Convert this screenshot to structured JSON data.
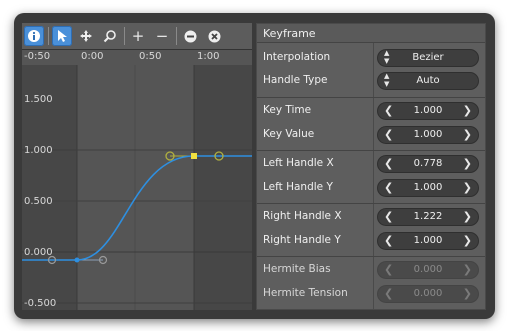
{
  "toolbar": {
    "info_icon": "info-icon",
    "select_icon": "arrow-icon",
    "pan_icon": "move-icon",
    "zoom_icon": "magnify-icon",
    "zoom_in_label": "+",
    "zoom_out_label": "−",
    "add_icon": "minus-circle-icon",
    "delete_icon": "close-circle-icon"
  },
  "ruler": {
    "ticks": [
      "-0:50",
      "0:00",
      "0:50",
      "1:00"
    ]
  },
  "y_labels": [
    "1.500",
    "1.000",
    "0.500",
    "0.000",
    "-0.500"
  ],
  "panel": {
    "title": "Keyframe",
    "interpolation": {
      "label": "Interpolation",
      "value": "Bezier"
    },
    "handle_type": {
      "label": "Handle Type",
      "value": "Auto"
    },
    "key_time": {
      "label": "Key Time",
      "value": "1.000"
    },
    "key_value": {
      "label": "Key Value",
      "value": "1.000"
    },
    "left_handle_x": {
      "label": "Left Handle X",
      "value": "0.778"
    },
    "left_handle_y": {
      "label": "Left Handle Y",
      "value": "1.000"
    },
    "right_handle_x": {
      "label": "Right Handle X",
      "value": "1.222"
    },
    "right_handle_y": {
      "label": "Right Handle Y",
      "value": "1.000"
    },
    "hermite_bias": {
      "label": "Hermite Bias",
      "value": "0.000"
    },
    "hermite_tension": {
      "label": "Hermite Tension",
      "value": "0.000"
    }
  },
  "colors": {
    "accent": "#4a90d9",
    "curve": "#2e8fe0",
    "selected_key": "#f0e040",
    "handle": "#b0b040"
  }
}
